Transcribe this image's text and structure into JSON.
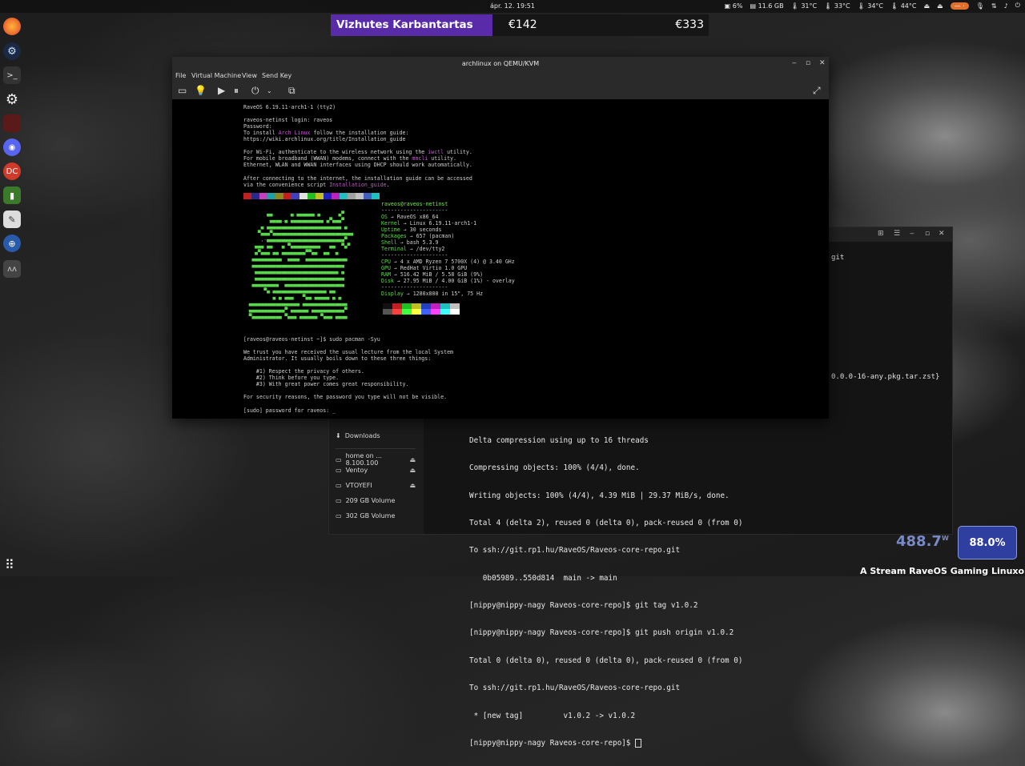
{
  "topbar": {
    "clock": "ápr. 12.  19:51",
    "tray": [
      "6%",
      "11.6 GB",
      "31°C",
      "33°C",
      "34°C",
      "44°C"
    ],
    "pill": "— ·"
  },
  "dock": {
    "icons": [
      "firefox-icon",
      "steam-icon",
      "terminal-icon",
      "settings-icon",
      "app-icon",
      "discord-icon",
      "dc-icon",
      "file-icon",
      "notes-icon",
      "network-icon",
      "raveos-icon"
    ]
  },
  "media": {
    "title": "Vizhutes Karbantartas",
    "price1": "€142",
    "price2": "€333"
  },
  "vm": {
    "title": "archlinux on QEMU/KVM",
    "menu": [
      "File",
      "Virtual Machine",
      "View",
      "Send Key"
    ]
  },
  "console": {
    "header": "RaveOS 6.19.11-arch1-1 (tty2)",
    "login": "raveos-netinst login: raveos",
    "password": "Password:",
    "install1_pre": "To install ",
    "install1_link": "Arch Linux",
    "install1_post": " follow the installation guide:",
    "install2": "https://wiki.archlinux.org/title/Installation_guide",
    "wifi1_pre": "For Wi-Fi, authenticate to the wireless network using the ",
    "wifi1_link": "iwctl",
    "wifi1_post": " utility.",
    "wifi2_pre": "For mobile broadband (WWAN) modems, connect with the ",
    "wifi2_link": "mmcli",
    "wifi2_post": " utility.",
    "wifi3": "Ethernet, WLAN and WWAN interfaces using DHCP should work automatically.",
    "after1": "After connecting to the internet, the installation guide can be accessed",
    "after2_pre": "via the convenience script ",
    "after2_link": "Installation_guide",
    "after2_post": ".",
    "prompt_cmd": "[raveos@raveos-netinst ~]$ sudo pacman -Syu",
    "lecture1": "We trust you have received the usual lecture from the local System",
    "lecture2": "Administrator. It usually boils down to these three things:",
    "rule1": "    #1) Respect the privacy of others.",
    "rule2": "    #2) Think before you type.",
    "rule3": "    #3) With great power comes great responsibility.",
    "security": "For security reasons, the password you type will not be visible.",
    "sudo": "[sudo] password for raveos: _"
  },
  "sysinfo": {
    "host": "raveos@raveos-netinst",
    "sep": "---------------------",
    "rows": [
      {
        "k": "OS",
        "v": " → RaveOS x86_64"
      },
      {
        "k": "Kernel",
        "v": " → Linux 6.19.11-arch1-1"
      },
      {
        "k": "Uptime",
        "v": " → 30 seconds"
      },
      {
        "k": "Packages",
        "v": " → 657 (pacman)"
      },
      {
        "k": "Shell",
        "v": " → bash 5.3.9"
      },
      {
        "k": "Terminal",
        "v": " → /dev/tty2"
      }
    ],
    "hw": [
      {
        "k": "CPU",
        "v": " → 4 x AMD Ryzen 7 5700X (4) @ 3.40 GHz"
      },
      {
        "k": "GPU",
        "v": " → RedHat Virtio 1.0 GPU"
      },
      {
        "k": "RAM",
        "v": " → 516.42 MiB / 5.58 GiB (9%)"
      },
      {
        "k": "Disk",
        "v": " → 27.95 MiB / 4.00 GiB (1%) - overlay"
      }
    ],
    "display": {
      "k": "Display",
      "v": " → 1280x800 in 15\", 75 Hz"
    }
  },
  "bgwin": {
    "frag_git": "git",
    "frag_pkg": "0.0.0-16-any.pkg.tar.zst}",
    "sidebar": [
      {
        "label": "Downloads",
        "icon": "download-icon",
        "eject": false
      },
      {
        "label": "home on ... 8.100.100",
        "icon": "network-drive-icon",
        "eject": true
      },
      {
        "label": "Ventoy",
        "icon": "drive-icon",
        "eject": true
      },
      {
        "label": "VTOYEFI",
        "icon": "drive-icon",
        "eject": true
      },
      {
        "label": "209 GB Volume",
        "icon": "drive-icon",
        "eject": false
      },
      {
        "label": "302 GB Volume",
        "icon": "drive-icon",
        "eject": false
      }
    ],
    "terminal": [
      "Delta compression using up to 16 threads",
      "Compressing objects: 100% (4/4), done.",
      "Writing objects: 100% (4/4), 4.39 MiB | 29.37 MiB/s, done.",
      "Total 4 (delta 2), reused 0 (delta 0), pack-reused 0 (from 0)",
      "To ssh://git.rp1.hu/RaveOS/Raveos-core-repo.git",
      "   0b05989..550d814  main -> main",
      "[nippy@nippy-nagy Raveos-core-repo]$ git tag v1.0.2",
      "[nippy@nippy-nagy Raveos-core-repo]$ git push origin v1.0.2",
      "Total 0 (delta 0), reused 0 (delta 0), pack-reused 0 (from 0)",
      "To ssh://git.rp1.hu/RaveOS/Raveos-core-repo.git",
      " * [new tag]         v1.0.2 -> v1.0.2",
      "[nippy@nippy-nagy Raveos-core-repo]$ "
    ]
  },
  "widgets": {
    "watts": "488.7",
    "watts_unit": "W",
    "percent": "88.0%",
    "ticker": "A Stream RaveOS Gaming Linuxon fut"
  },
  "colors": {
    "accent": "#5a2ba8",
    "logo_green": "#58d94a",
    "link_magenta": "#c45ccf"
  }
}
